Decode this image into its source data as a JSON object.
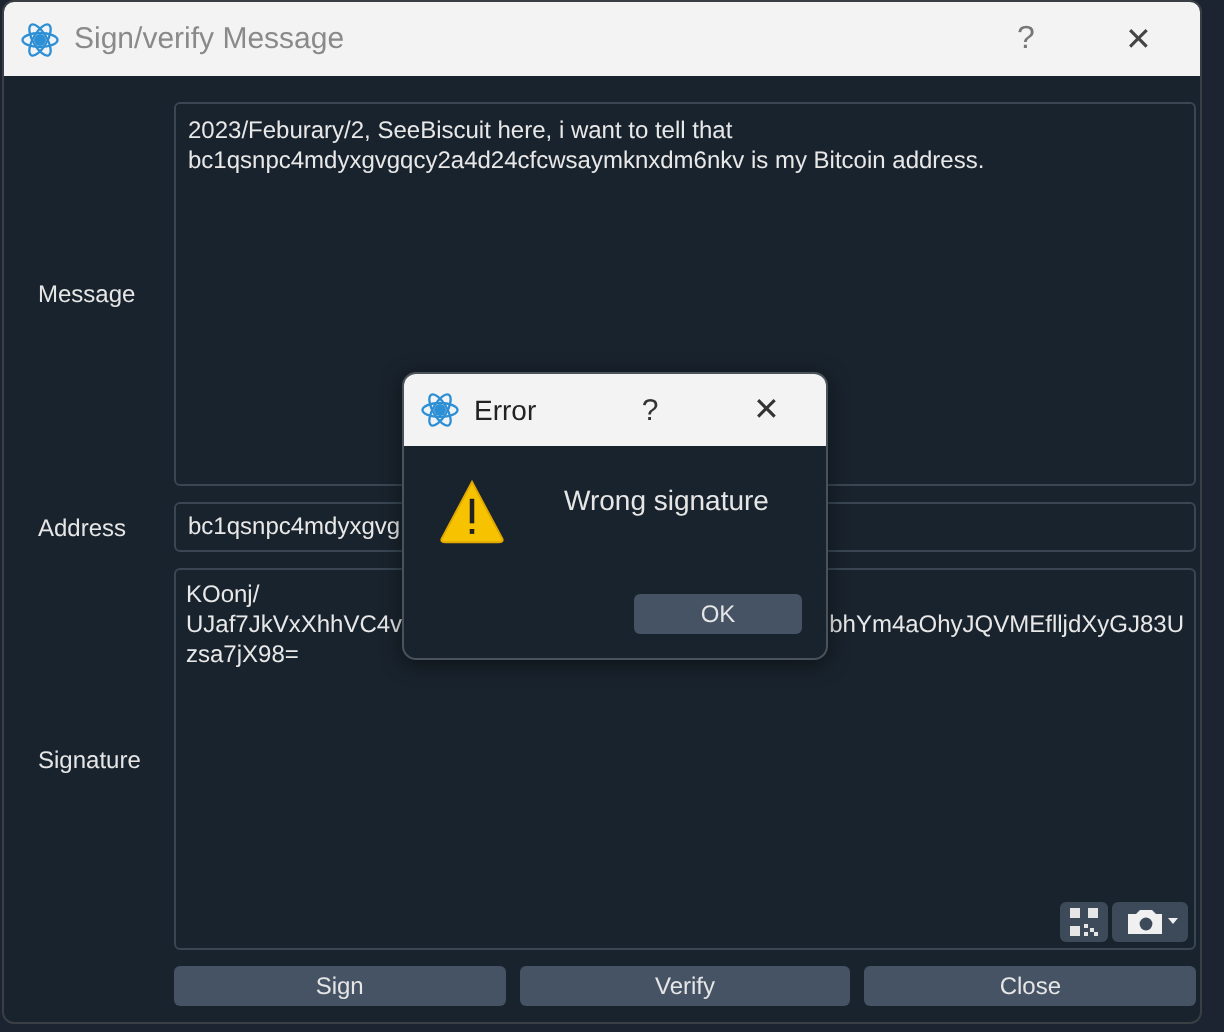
{
  "window": {
    "title": "Sign/verify Message",
    "help": "?",
    "close": "✕"
  },
  "form": [
    {
      "label": "Message",
      "kind": "message",
      "lines": [
        "2023/Feburary/2, SeeBiscuit here, i want to tell that",
        "bc1qsnpc4mdyxgvgqcy2a4d24cfcwsaymknxdm6nkv is my Bitcoin address."
      ]
    },
    {
      "label": "Address",
      "kind": "address",
      "value": "bc1qsnpc4mdyxgvg"
    },
    {
      "label": "Signature",
      "kind": "signature",
      "lines": [
        [
          "KOonj/"
        ],
        [
          "UJaf7JkVxXhhVC4v",
          "bhYm4aOhyJQVMEflljdXyGJ83U"
        ],
        [
          "zsa7jX98="
        ]
      ]
    }
  ],
  "buttons": [
    "Sign",
    "Verify",
    "Close"
  ],
  "dialog": {
    "title": "Error",
    "help": "?",
    "close": "✕",
    "message": "Wrong signature",
    "button": "OK"
  }
}
